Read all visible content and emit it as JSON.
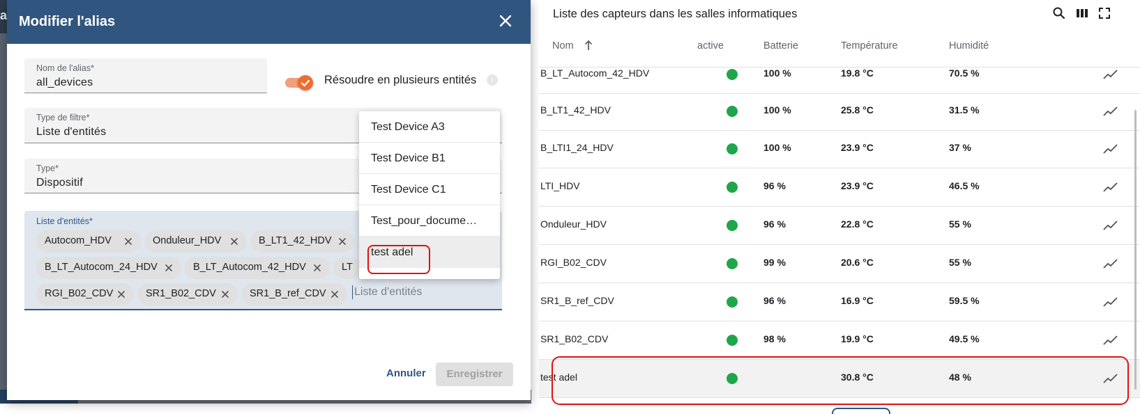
{
  "background": {
    "partial_app_letter": "a"
  },
  "dialog": {
    "title": "Modifier l'alias",
    "alias_field": {
      "label": "Nom de l'alias*",
      "value": "all_devices"
    },
    "resolve_toggle": {
      "label": "Résoudre en plusieurs entités",
      "checked": true
    },
    "filter_type": {
      "label": "Type de filtre*",
      "value": "Liste d'entités"
    },
    "type": {
      "label": "Type*",
      "value": "Dispositif"
    },
    "entity_list": {
      "label": "Liste d'entités*",
      "placeholder": "Liste d'entités",
      "chips": [
        "Autocom_HDV",
        "Onduleur_HDV",
        "B_LT1_42_HDV",
        "B_LT_Autocom_24_HDV",
        "B_LT_Autocom_42_HDV",
        "LT",
        "RGI_B02_CDV",
        "SR1_B02_CDV",
        "SR1_B_ref_CDV"
      ]
    },
    "dropdown_options": [
      "Test Device A3",
      "Test Device B1",
      "Test Device C1",
      "Test_pour_docume…",
      "test adel"
    ],
    "cancel_label": "Annuler",
    "save_label": "Enregistrer"
  },
  "sensors": {
    "title": "Liste des capteurs dans les salles informatiques",
    "columns": {
      "name": "Nom",
      "active": "active",
      "battery": "Batterie",
      "temperature": "Température",
      "humidity": "Humidité"
    },
    "rows": [
      {
        "name": "B_LT_Autocom_42_HDV",
        "battery": "100 %",
        "temperature": "19.8 °C",
        "humidity": "70.5 %"
      },
      {
        "name": "B_LT1_42_HDV",
        "battery": "100 %",
        "temperature": "25.8 °C",
        "humidity": "31.5 %"
      },
      {
        "name": "B_LTI1_24_HDV",
        "battery": "100 %",
        "temperature": "23.9 °C",
        "humidity": "37 %"
      },
      {
        "name": "LTI_HDV",
        "battery": "96 %",
        "temperature": "23.9 °C",
        "humidity": "46.5 %"
      },
      {
        "name": "Onduleur_HDV",
        "battery": "96 %",
        "temperature": "22.8 °C",
        "humidity": "55 %"
      },
      {
        "name": "RGI_B02_CDV",
        "battery": "99 %",
        "temperature": "20.6 °C",
        "humidity": "55 %"
      },
      {
        "name": "SR1_B_ref_CDV",
        "battery": "96 %",
        "temperature": "16.9 °C",
        "humidity": "59.5 %"
      },
      {
        "name": "SR1_B02_CDV",
        "battery": "98 %",
        "temperature": "19.9 °C",
        "humidity": "49.5 %"
      },
      {
        "name": "test adel",
        "battery": "",
        "temperature": "30.8 °C",
        "humidity": "48 %"
      }
    ]
  },
  "colors": {
    "header_blue": "#305680",
    "toggle_orange": "#ee6d30",
    "active_green": "#1fa64a",
    "highlight_red": "#e01010"
  }
}
